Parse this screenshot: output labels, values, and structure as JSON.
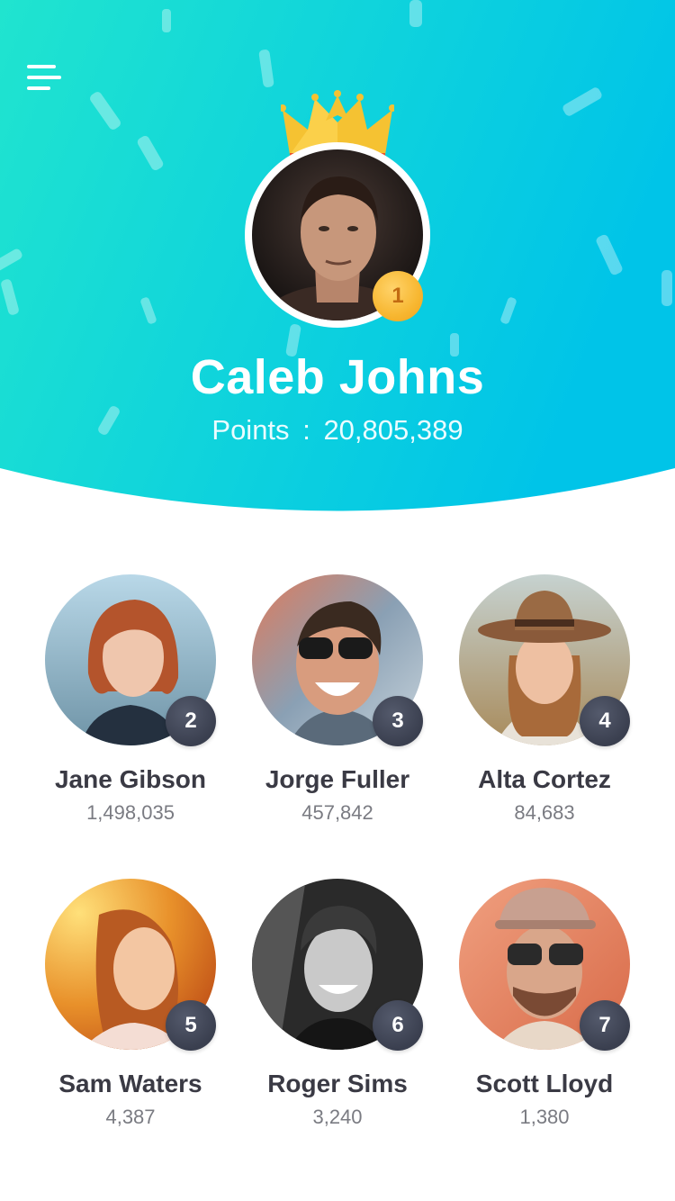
{
  "header": {
    "menu_icon": "hamburger-menu-icon",
    "crown_icon": "crown-icon",
    "champion": {
      "rank": "1",
      "name": "Caleb Johns",
      "points_label": "Points",
      "points_separator": ":",
      "points_value": "20,805,389"
    }
  },
  "leaderboard": [
    {
      "rank": "2",
      "name": "Jane Gibson",
      "points": "1,498,035"
    },
    {
      "rank": "3",
      "name": "Jorge Fuller",
      "points": "457,842"
    },
    {
      "rank": "4",
      "name": "Alta Cortez",
      "points": "84,683"
    },
    {
      "rank": "5",
      "name": "Sam Waters",
      "points": "4,387"
    },
    {
      "rank": "6",
      "name": "Roger Sims",
      "points": "3,240"
    },
    {
      "rank": "7",
      "name": "Scott Lloyd",
      "points": "1,380"
    }
  ],
  "colors": {
    "header_gradient_start": "#1ee2d2",
    "header_gradient_end": "#00c6e6",
    "gold_badge": "#f7b731",
    "dark_badge": "#3a3f4f",
    "name_text": "#3a3a44",
    "score_text": "#7a7b82"
  }
}
